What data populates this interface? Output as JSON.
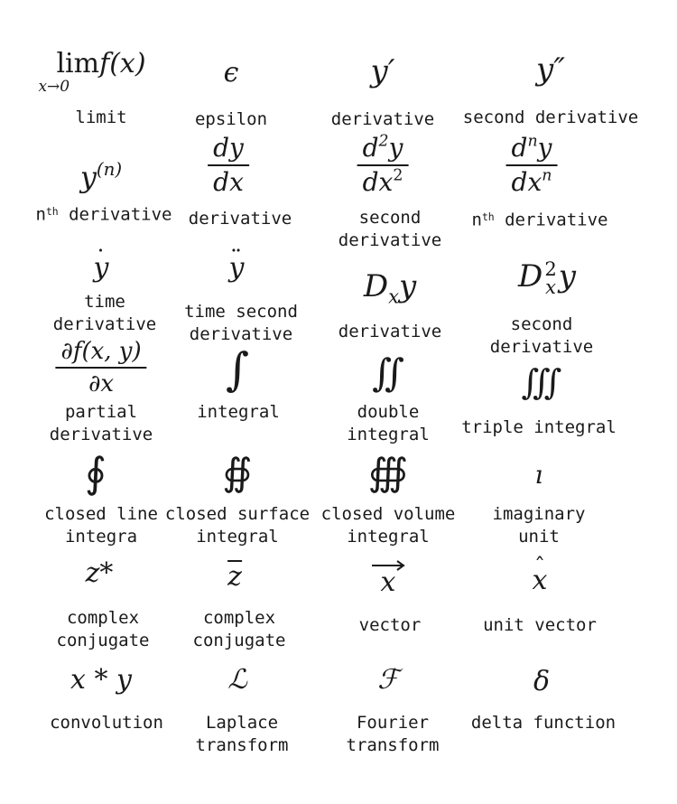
{
  "items": [
    {
      "label": [
        "limit"
      ],
      "limit_text": "lim",
      "limit_func": "f(x)",
      "limit_sub": "x→0"
    },
    {
      "label": [
        "epsilon"
      ],
      "symbol": "ϵ"
    },
    {
      "label": [
        "derivative"
      ],
      "symbol": "y′"
    },
    {
      "label": [
        "second derivative"
      ],
      "symbol": "y″"
    },
    {
      "label": [
        "n",
        "th",
        " derivative"
      ],
      "base": "y",
      "sup": "(n)"
    },
    {
      "label": [
        "derivative"
      ],
      "num": "dy",
      "den": "dx"
    },
    {
      "label": [
        "second",
        "derivative"
      ],
      "num_base": "d",
      "num_sup": "2",
      "num_rest": "y",
      "den_base": "dx",
      "den_sup": "2"
    },
    {
      "label": [
        "n",
        "th",
        " derivative"
      ],
      "num_base": "d",
      "num_sup": "n",
      "num_rest": "y",
      "den_base": "dx",
      "den_sup": "n"
    },
    {
      "label": [
        "time",
        "derivative"
      ],
      "symbol": "y",
      "dots": "˙"
    },
    {
      "label": [
        "time second",
        "derivative"
      ],
      "symbol": "y",
      "dots": "¨"
    },
    {
      "label": [
        "derivative"
      ],
      "base": "D",
      "sub": "x",
      "rest": "y"
    },
    {
      "label": [
        "second",
        "derivative"
      ],
      "base": "D",
      "sup": "2",
      "sub": "x",
      "rest": "y"
    },
    {
      "label": [
        "partial",
        "derivative"
      ],
      "num": "∂f(x, y)",
      "den": "∂x"
    },
    {
      "label": [
        "integral"
      ],
      "symbol": "∫"
    },
    {
      "label": [
        "double",
        "integral"
      ],
      "symbol": "∬"
    },
    {
      "label": [
        "triple integral"
      ],
      "symbol": "∭"
    },
    {
      "label": [
        "closed line",
        "integra"
      ],
      "symbol": "∮"
    },
    {
      "label": [
        "closed surface",
        "integral"
      ],
      "symbol": "∯"
    },
    {
      "label": [
        "closed volume",
        "integral"
      ],
      "symbol": "∰"
    },
    {
      "label": [
        "imaginary",
        "unit"
      ],
      "symbol": "ı"
    },
    {
      "label": [
        "complex",
        "conjugate"
      ],
      "symbol": "z*"
    },
    {
      "label": [
        "complex",
        "conjugate"
      ],
      "symbol": "z"
    },
    {
      "label": [
        "vector"
      ],
      "symbol": "x"
    },
    {
      "label": [
        "unit vector"
      ],
      "symbol": "x",
      "mark": "ˆ"
    },
    {
      "label": [
        "convolution"
      ],
      "symbol": "x * y"
    },
    {
      "label": [
        "Laplace",
        "transform"
      ],
      "symbol": "ℒ"
    },
    {
      "label": [
        "Fourier",
        "transform"
      ],
      "symbol": "ℱ"
    },
    {
      "label": [
        "delta function"
      ],
      "symbol": "δ"
    }
  ]
}
